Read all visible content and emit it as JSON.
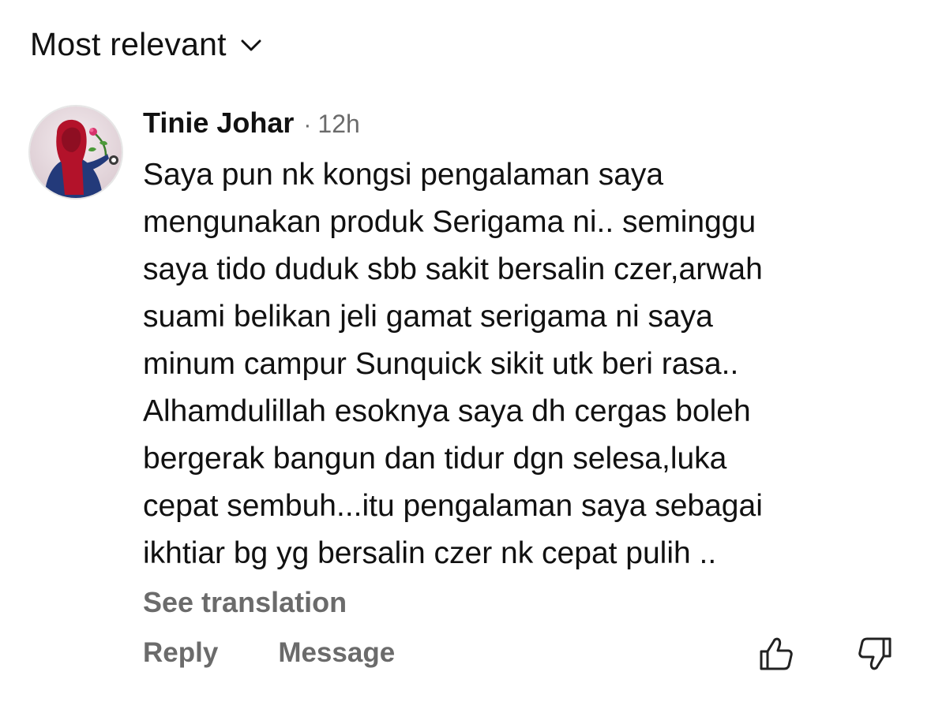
{
  "sort": {
    "label": "Most relevant",
    "icon": "chevron-down-icon"
  },
  "comment": {
    "author": "Tinie Johar",
    "separator": "·",
    "time": "12h",
    "avatar_icon": "user-avatar",
    "lines": [
      "Saya pun nk kongsi pengalaman saya",
      "mengunakan produk Serigama ni.. seminggu",
      "saya tido duduk sbb sakit bersalin czer,arwah",
      "suami belikan jeli gamat serigama ni saya",
      "minum campur Sunquick sikit utk beri rasa..",
      "Alhamdulillah esoknya saya dh cergas boleh",
      "bergerak bangun dan tidur dgn selesa,luka",
      "cepat sembuh...itu pengalaman saya sebagai",
      "ikhtiar bg yg bersalin czer nk cepat pulih .."
    ],
    "see_translation": "See translation",
    "actions": {
      "reply": "Reply",
      "message": "Message"
    },
    "icons": {
      "like": "thumbs-up-icon",
      "dislike": "thumbs-down-icon"
    }
  },
  "colors": {
    "text": "#111111",
    "muted": "#6b6b6b",
    "background": "#ffffff"
  }
}
